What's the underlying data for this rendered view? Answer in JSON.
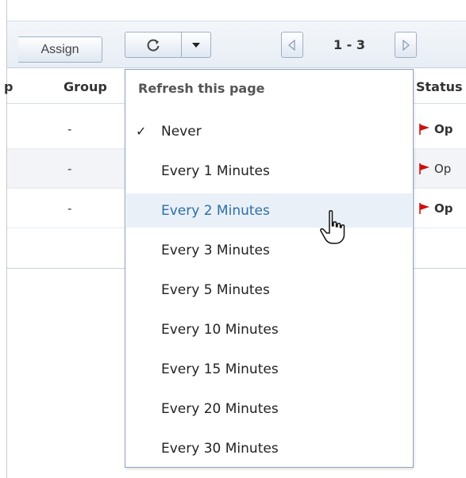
{
  "toolbar": {
    "assign_label": "Assign",
    "refresh_icon": "refresh-icon",
    "dropdown_icon": "caret-down-icon",
    "pager_text": "1 - 3"
  },
  "grid": {
    "columns": {
      "col0": "p",
      "group": "Group",
      "status": "Status"
    },
    "rows": [
      {
        "group": "-",
        "status": "Op",
        "status_bold": true
      },
      {
        "group": "-",
        "status": "Op",
        "status_bold": false
      },
      {
        "group": "-",
        "status": "Op",
        "status_bold": true
      }
    ]
  },
  "refresh_menu": {
    "heading": "Refresh this page",
    "checkmark": "✓",
    "items": [
      {
        "label": "Never",
        "checked": true
      },
      {
        "label": "Every 1 Minutes"
      },
      {
        "label": "Every 2 Minutes",
        "hovered": true
      },
      {
        "label": "Every 3 Minutes"
      },
      {
        "label": "Every 5 Minutes"
      },
      {
        "label": "Every 10 Minutes"
      },
      {
        "label": "Every 15 Minutes"
      },
      {
        "label": "Every 20 Minutes"
      },
      {
        "label": "Every 30 Minutes"
      }
    ]
  },
  "colors": {
    "flag": "#d10d0d",
    "hover_bg": "#e9f0f7",
    "hover_text": "#2e6ea6",
    "menu_border": "#8ea3bc"
  }
}
